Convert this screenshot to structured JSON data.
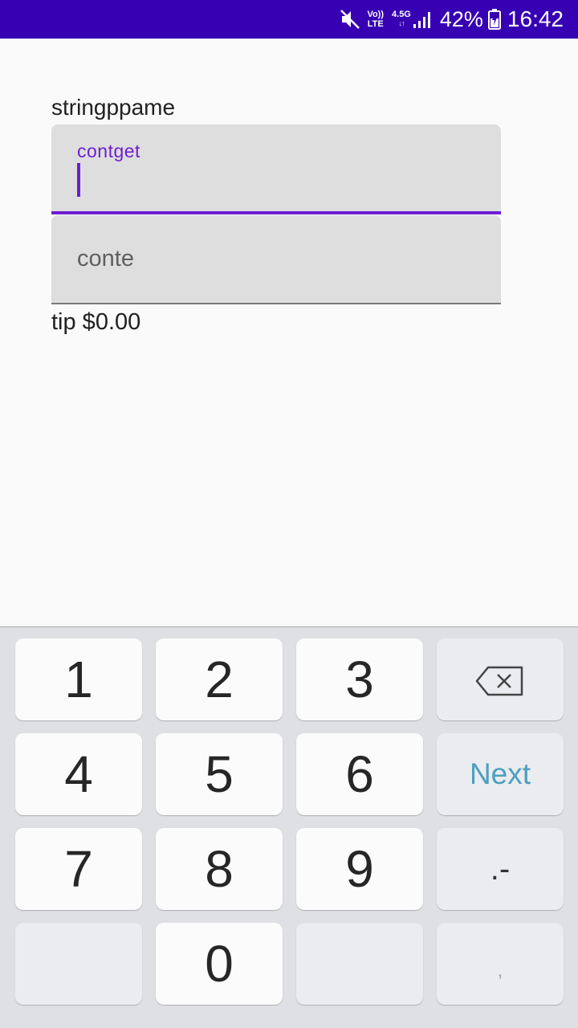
{
  "status_bar": {
    "volte_top": "Vo))",
    "volte_bottom": "LTE",
    "network_type": "4.5G",
    "network_arrows": "↓↑",
    "battery_percent": "42%",
    "time": "16:42",
    "icons": [
      "mute-icon",
      "signal-icon",
      "battery-charging-icon"
    ]
  },
  "app": {
    "title": "stringppame",
    "field1": {
      "label": "contget",
      "value": ""
    },
    "field2": {
      "placeholder": "conte",
      "value": ""
    },
    "tip_text": "tip $0.00",
    "colors": {
      "accent": "#6e1ed0",
      "status_bar": "#3700b3"
    }
  },
  "keyboard": {
    "keys": {
      "k1": "1",
      "k2": "2",
      "k3": "3",
      "k4": "4",
      "k5": "5",
      "k6": "6",
      "k7": "7",
      "k8": "8",
      "k9": "9",
      "k0": "0"
    },
    "next_label": "Next",
    "dot_dash_label": ".-",
    "comma_label": ",",
    "backspace_icon": "backspace-icon",
    "colors": {
      "next": "#4c9fbf"
    }
  }
}
